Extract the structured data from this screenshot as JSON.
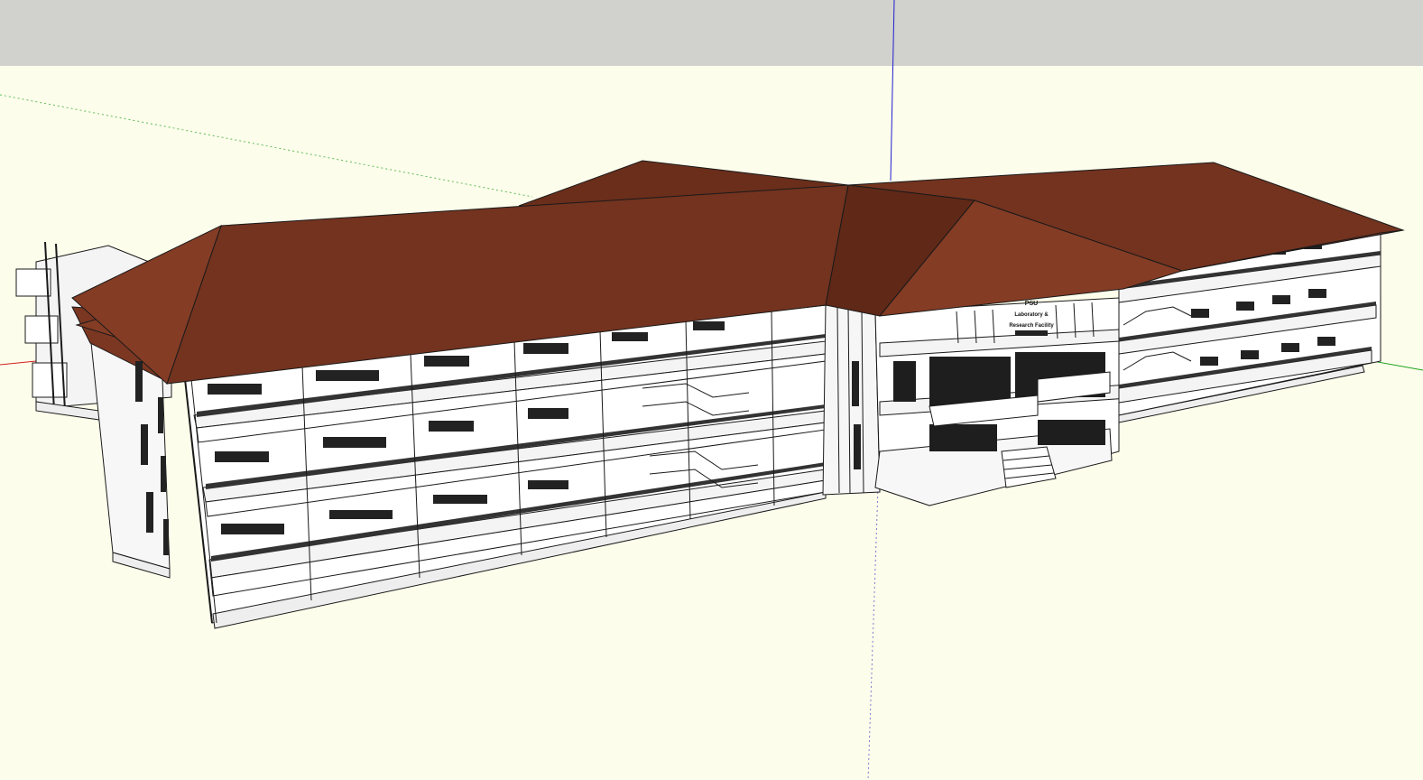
{
  "viewport": {
    "sky_color": "#D1D1CD",
    "ground_color": "#FDFDEB",
    "roof_color": "#73331F",
    "roof_dark_color": "#5F2817",
    "roof_light_color": "#843C25",
    "wall_color": "#FFFFFF",
    "line_color": "#1A1A1A",
    "axis_red": "#D11F1F",
    "axis_green": "#1FA31F",
    "axis_blue": "#1F1FD1"
  },
  "signage": {
    "line1": "PSU",
    "line2": "Laboratory &",
    "line3": "Research Facility"
  }
}
